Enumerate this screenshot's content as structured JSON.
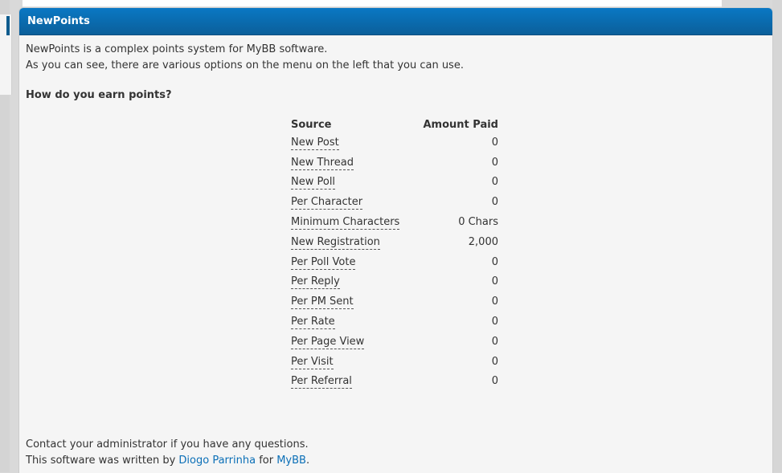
{
  "panel": {
    "title": "NewPoints"
  },
  "intro": {
    "line1": "NewPoints is a complex points system for MyBB software.",
    "line2": "As you can see, there are various options on the menu on the left that you can use."
  },
  "earn": {
    "title": "How do you earn points?",
    "headers": {
      "source": "Source",
      "amount": "Amount Paid"
    },
    "rows": [
      {
        "source": "New Post",
        "amount": "0"
      },
      {
        "source": "New Thread",
        "amount": "0"
      },
      {
        "source": "New Poll",
        "amount": "0"
      },
      {
        "source": "Per Character",
        "amount": "0"
      },
      {
        "source": "Minimum Characters",
        "amount": "0 Chars"
      },
      {
        "source": "New Registration",
        "amount": "2,000"
      },
      {
        "source": "Per Poll Vote",
        "amount": "0"
      },
      {
        "source": "Per Reply",
        "amount": "0"
      },
      {
        "source": "Per PM Sent",
        "amount": "0"
      },
      {
        "source": "Per Rate",
        "amount": "0"
      },
      {
        "source": "Per Page View",
        "amount": "0"
      },
      {
        "source": "Per Visit",
        "amount": "0"
      },
      {
        "source": "Per Referral",
        "amount": "0"
      }
    ]
  },
  "footer": {
    "contact": "Contact your administrator if you have any questions.",
    "written_prefix": "This software was written by",
    "author": "Diogo Parrinha",
    "for_word": "for",
    "product": "MyBB",
    "end": "."
  },
  "colors": {
    "header": "#0b6bb0",
    "link": "#0b6fb7",
    "panel_bg": "#f5f5f5"
  }
}
